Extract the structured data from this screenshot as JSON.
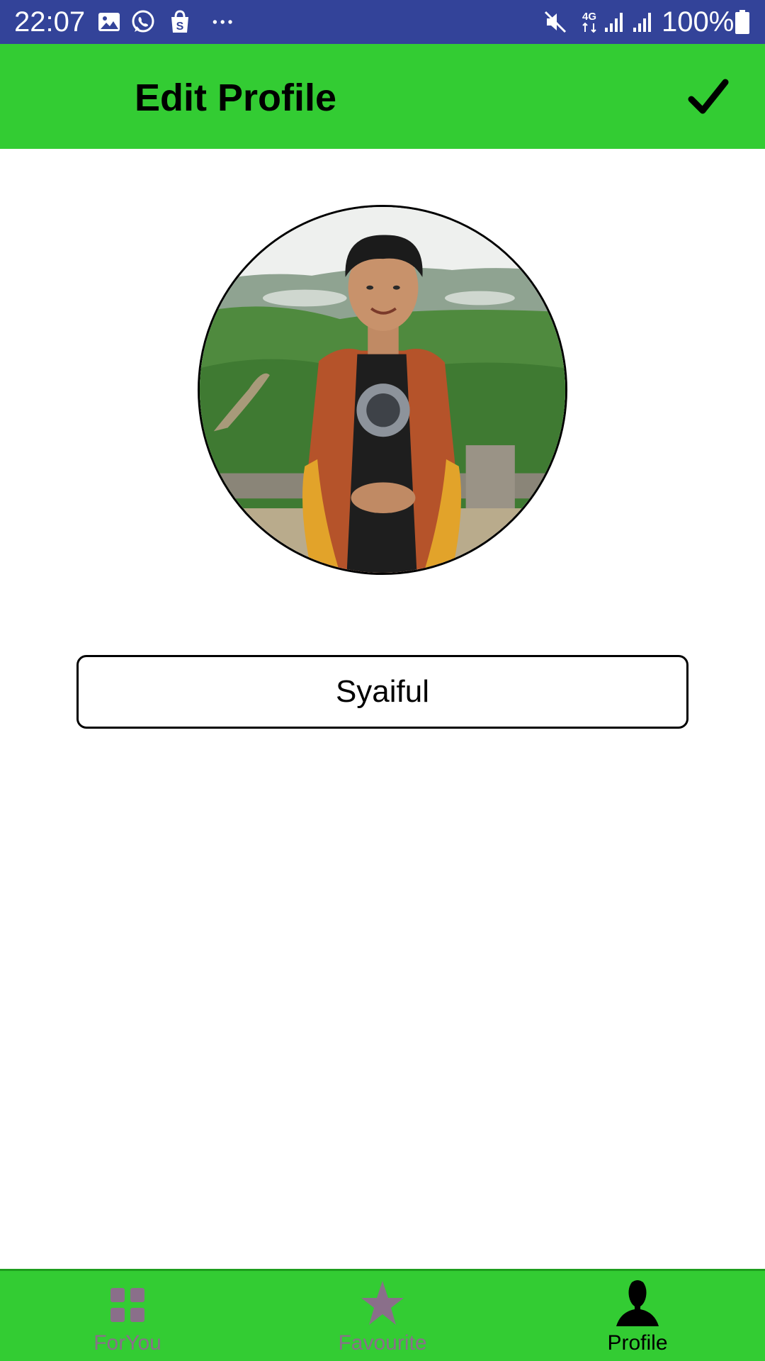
{
  "status_bar": {
    "time": "22:07",
    "battery_percent": "100%",
    "network_type": "4G",
    "icons": [
      "gallery-icon",
      "whatsapp-icon",
      "shop-icon",
      "more-dots-icon",
      "mute-icon",
      "network-4g-icon",
      "signal-icon",
      "signal-icon",
      "battery-icon"
    ],
    "background_color": "#334399"
  },
  "app_bar": {
    "title": "Edit Profile",
    "confirm_icon": "check-icon",
    "background_color": "#33cc33"
  },
  "profile": {
    "avatar_icon": "profile-photo",
    "name_value": "Syaiful"
  },
  "bottom_nav": {
    "background_color": "#33cc33",
    "items": [
      {
        "label": "ForYou",
        "icon": "grid-icon",
        "active": false
      },
      {
        "label": "Favourite",
        "icon": "star-icon",
        "active": false
      },
      {
        "label": "Profile",
        "icon": "person-icon",
        "active": true
      }
    ],
    "inactive_color": "#8a6f8a",
    "active_color": "#000000"
  }
}
